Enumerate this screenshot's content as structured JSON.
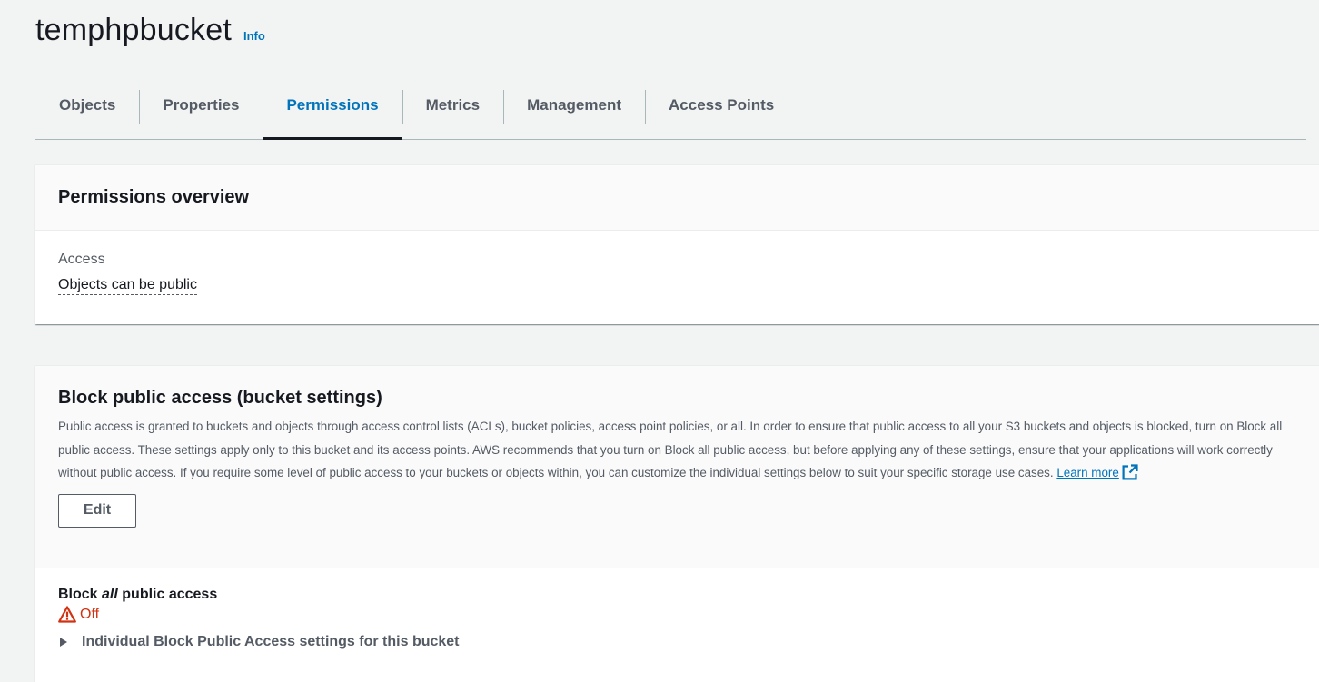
{
  "header": {
    "bucket_name": "temphpbucket",
    "info_label": "Info"
  },
  "tabs": [
    {
      "label": "Objects",
      "active": false
    },
    {
      "label": "Properties",
      "active": false
    },
    {
      "label": "Permissions",
      "active": true
    },
    {
      "label": "Metrics",
      "active": false
    },
    {
      "label": "Management",
      "active": false
    },
    {
      "label": "Access Points",
      "active": false
    }
  ],
  "overview": {
    "title": "Permissions overview",
    "access_label": "Access",
    "access_value": "Objects can be public"
  },
  "block_public_access": {
    "title": "Block public access (bucket settings)",
    "description": "Public access is granted to buckets and objects through access control lists (ACLs), bucket policies, access point policies, or all. In order to ensure that public access to all your S3 buckets and objects is blocked, turn on Block all public access. These settings apply only to this bucket and its access points. AWS recommends that you turn on Block all public access, but before applying any of these settings, ensure that your applications will work correctly without public access. If you require some level of public access to your buckets or objects within, you can customize the individual settings below to suit your specific storage use cases.",
    "learn_more": "Learn more",
    "edit_label": "Edit",
    "setting_prefix": "Block",
    "setting_emphasis": "all",
    "setting_suffix": "public access",
    "status_value": "Off",
    "expander_label": "Individual Block Public Access settings for this bucket"
  },
  "colors": {
    "accent": "#0073bb",
    "status_off": "#d13212",
    "background": "#f2f3f3"
  },
  "icons": {
    "external_link": "external-link-icon",
    "warning": "warning-icon",
    "caret": "caret-right-icon"
  }
}
